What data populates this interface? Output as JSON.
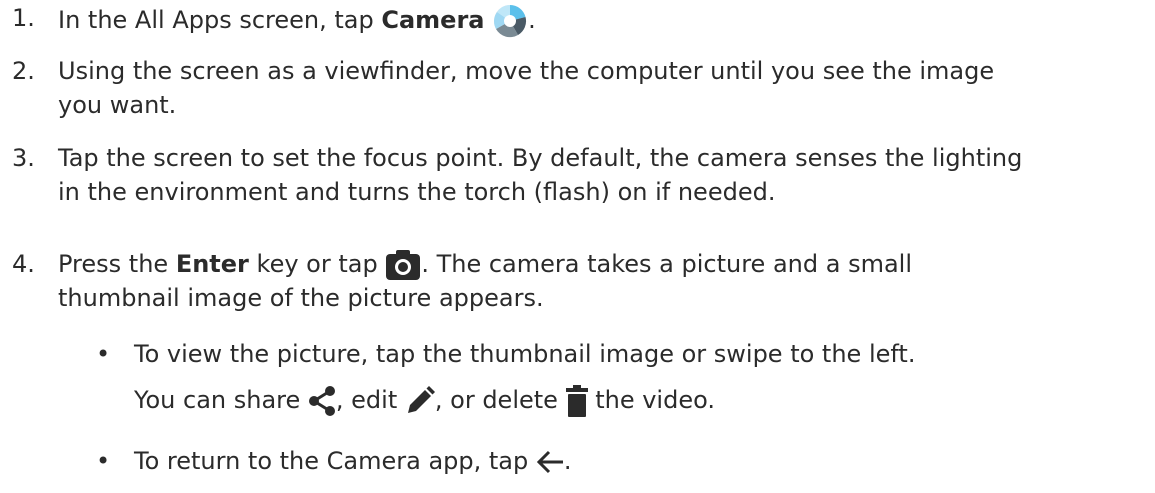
{
  "steps": [
    {
      "number": "1.",
      "pre": "In the All Apps screen, tap ",
      "bold": "Camera",
      "post": ".",
      "icon": "camera-app-icon"
    },
    {
      "number": "2.",
      "line1": "Using the screen as a viewfinder, move the computer until you see the image",
      "line2": "you want."
    },
    {
      "number": "3.",
      "line1": "Tap the screen to set the focus point. By default, the camera senses the lighting",
      "line2": "in the environment and turns the torch (flash) on if needed."
    },
    {
      "number": "4.",
      "pre": "Press the ",
      "bold": "Enter",
      "mid": " key or tap ",
      "post": ". The camera takes a picture and a small",
      "line2": "thumbnail image of the picture appears.",
      "icon": "camera-shutter-icon"
    }
  ],
  "bullets": [
    {
      "line1": "To view the picture, tap the thumbnail image or swipe to the left.",
      "l2_a": "You can share ",
      "l2_b": ", edit ",
      "l2_c": ", or delete ",
      "l2_d": " the video.",
      "icons": [
        "share-icon",
        "edit-pencil-icon",
        "trash-icon"
      ]
    },
    {
      "pre": "To return to the Camera app, tap ",
      "post": ".",
      "icon": "back-arrow-icon"
    }
  ],
  "bullet_symbol": "•"
}
